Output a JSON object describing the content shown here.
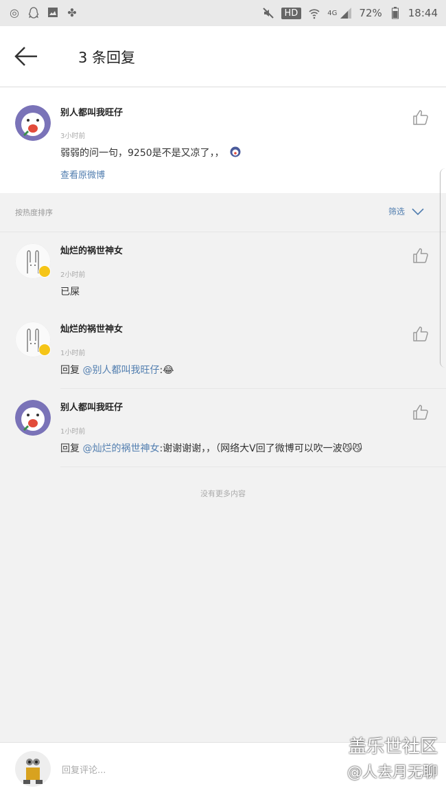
{
  "status_bar": {
    "battery": "72%",
    "time": "18:44",
    "hd": "HD",
    "network": "4G",
    "left_icons": [
      "netease-icon",
      "qq-icon",
      "gallery-icon",
      "leaf-icon"
    ],
    "right_icons": [
      "mute-icon",
      "hd-icon",
      "wifi-icon",
      "signal-icon",
      "battery-icon"
    ]
  },
  "header": {
    "title": "3 条回复"
  },
  "root_comment": {
    "name": "别人都叫我旺仔",
    "time": "3小时前",
    "text": "弱弱的问一句，9250是不是又凉了，，",
    "view_original": "查看原微博"
  },
  "sort_bar": {
    "label": "按热度排序",
    "filter": "筛选"
  },
  "replies": [
    {
      "name": "灿烂的祸世神女",
      "time": "2小时前",
      "text": "已屎",
      "prefix": "",
      "mention": "",
      "suffix": ""
    },
    {
      "name": "灿烂的祸世神女",
      "time": "1小时前",
      "prefix": "回复 ",
      "mention": "@别人都叫我旺仔",
      "suffix": ":😂"
    },
    {
      "name": "别人都叫我旺仔",
      "time": "1小时前",
      "prefix": "回复 ",
      "mention": "@灿烂的祸世神女",
      "suffix": ":谢谢谢谢，，（网络大V回了微博可以吹一波😼😼"
    }
  ],
  "no_more": "没有更多内容",
  "bottom_bar": {
    "placeholder": "回复评论..."
  },
  "watermark": {
    "line1": "盖乐世社区",
    "line2": "@人去月无聊"
  },
  "colors": {
    "link": "#507daf",
    "background": "#f2f2f2"
  }
}
